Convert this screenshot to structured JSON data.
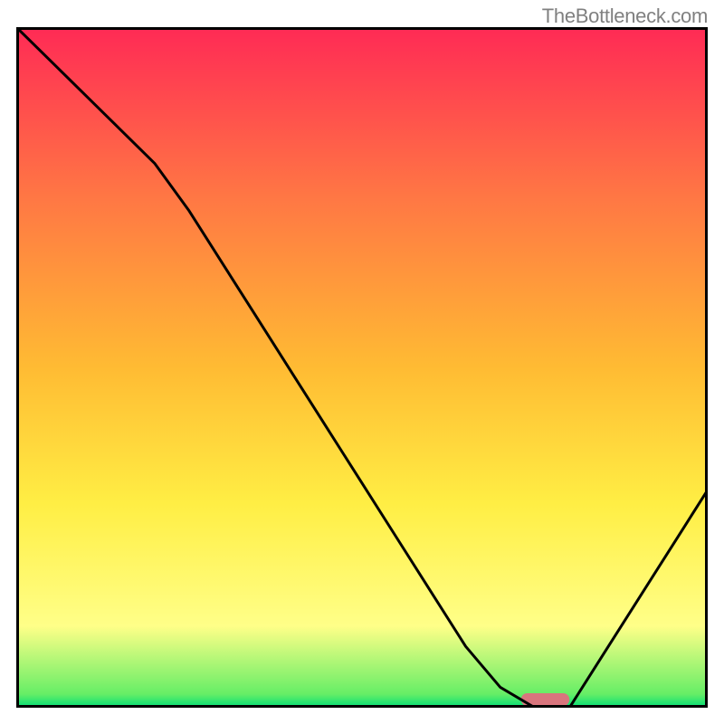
{
  "watermark": "TheBottleneck.com",
  "chart_data": {
    "type": "line",
    "title": "",
    "xlabel": "",
    "ylabel": "",
    "xlim": [
      0,
      100
    ],
    "ylim": [
      0,
      100
    ],
    "categories": [
      0,
      5,
      10,
      15,
      20,
      25,
      30,
      35,
      40,
      45,
      50,
      55,
      60,
      65,
      70,
      75,
      80,
      85,
      90,
      95,
      100
    ],
    "values": [
      100,
      95,
      90,
      85,
      80,
      73,
      65,
      57,
      49,
      41,
      33,
      25,
      17,
      9,
      3,
      0,
      0,
      8,
      16,
      24,
      32
    ],
    "marker": {
      "x_start": 73,
      "x_end": 80,
      "color": "#d9757d"
    },
    "gradient_stops": [
      {
        "offset": 0.0,
        "color": "#ff2a55"
      },
      {
        "offset": 0.25,
        "color": "#ff7744"
      },
      {
        "offset": 0.5,
        "color": "#ffbb33"
      },
      {
        "offset": 0.7,
        "color": "#ffee44"
      },
      {
        "offset": 0.88,
        "color": "#ffff88"
      },
      {
        "offset": 0.98,
        "color": "#66ee66"
      },
      {
        "offset": 1.0,
        "color": "#00dd77"
      }
    ],
    "border_color": "#000000",
    "curve_color": "#000000"
  }
}
